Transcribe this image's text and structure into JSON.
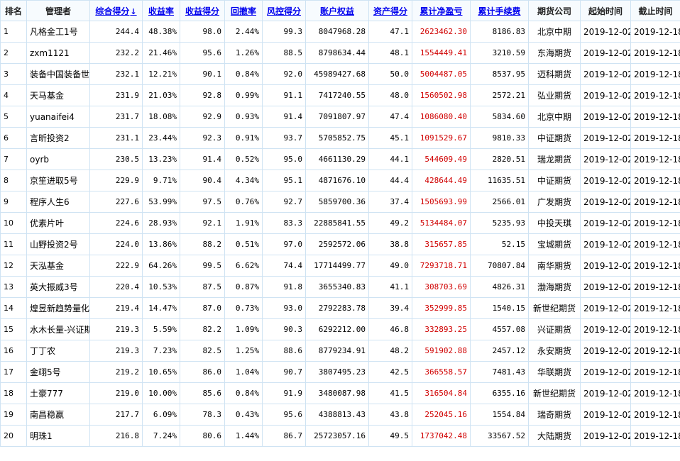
{
  "columns": [
    {
      "key": "rank",
      "label": "排名",
      "sortable": false
    },
    {
      "key": "manager",
      "label": "管理者",
      "sortable": false
    },
    {
      "key": "overall",
      "label": "综合得分",
      "sortable": true,
      "sort_indicator": "↓"
    },
    {
      "key": "return_rate",
      "label": "收益率",
      "sortable": true
    },
    {
      "key": "return_score",
      "label": "收益得分",
      "sortable": true
    },
    {
      "key": "drawdown",
      "label": "回撤率",
      "sortable": true
    },
    {
      "key": "risk_score",
      "label": "风控得分",
      "sortable": true
    },
    {
      "key": "equity",
      "label": "账户权益",
      "sortable": true
    },
    {
      "key": "asset_score",
      "label": "资产得分",
      "sortable": true
    },
    {
      "key": "net_profit",
      "label": "累计净盈亏",
      "sortable": true
    },
    {
      "key": "fees",
      "label": "累计手续费",
      "sortable": true
    },
    {
      "key": "broker",
      "label": "期货公司",
      "sortable": false
    },
    {
      "key": "start",
      "label": "起始时间",
      "sortable": false
    },
    {
      "key": "end",
      "label": "截止时间",
      "sortable": false
    }
  ],
  "colors": {
    "link": "#0000ee",
    "profit": "#d00000",
    "border": "#cfe3f3",
    "sort_arrow": "#e00000"
  },
  "rows": [
    [
      "1",
      "凡格金工1号",
      "244.4",
      "48.38%",
      "98.0",
      "2.44%",
      "99.3",
      "8047968.28",
      "47.1",
      "2623462.30",
      "8186.83",
      "北京中期",
      "2019-12-02",
      "2019-12-18"
    ],
    [
      "2",
      "zxm1121",
      "232.2",
      "21.46%",
      "95.6",
      "1.26%",
      "88.5",
      "8798634.44",
      "48.1",
      "1554449.41",
      "3210.59",
      "东海期货",
      "2019-12-02",
      "2019-12-18"
    ],
    [
      "3",
      "装备中国装备世",
      "232.1",
      "12.21%",
      "90.1",
      "0.84%",
      "92.0",
      "45989427.68",
      "50.0",
      "5004487.05",
      "8537.95",
      "迈科期货",
      "2019-12-02",
      "2019-12-18"
    ],
    [
      "4",
      "天马基金",
      "231.9",
      "21.03%",
      "92.8",
      "0.99%",
      "91.1",
      "7417240.55",
      "48.0",
      "1560502.98",
      "2572.21",
      "弘业期货",
      "2019-12-02",
      "2019-12-18"
    ],
    [
      "5",
      "yuanaifei4",
      "231.7",
      "18.08%",
      "92.9",
      "0.93%",
      "91.4",
      "7091807.97",
      "47.4",
      "1086080.40",
      "5834.60",
      "北京中期",
      "2019-12-02",
      "2019-12-18"
    ],
    [
      "6",
      "言昕投资2",
      "231.1",
      "23.44%",
      "92.3",
      "0.91%",
      "93.7",
      "5705852.75",
      "45.1",
      "1091529.67",
      "9810.33",
      "中证期货",
      "2019-12-02",
      "2019-12-18"
    ],
    [
      "7",
      "oyrb",
      "230.5",
      "13.23%",
      "91.4",
      "0.52%",
      "95.0",
      "4661130.29",
      "44.1",
      "544609.49",
      "2820.51",
      "瑞龙期货",
      "2019-12-02",
      "2019-12-18"
    ],
    [
      "8",
      "京笙进取5号",
      "229.9",
      "9.71%",
      "90.4",
      "4.34%",
      "95.1",
      "4871676.10",
      "44.4",
      "428644.49",
      "11635.51",
      "中证期货",
      "2019-12-02",
      "2019-12-18"
    ],
    [
      "9",
      "程序人生6",
      "227.6",
      "53.99%",
      "97.5",
      "0.76%",
      "92.7",
      "5859700.36",
      "37.4",
      "1505693.99",
      "2566.01",
      "广发期货",
      "2019-12-02",
      "2019-12-18"
    ],
    [
      "10",
      "优素片叶",
      "224.6",
      "28.93%",
      "92.1",
      "1.91%",
      "83.3",
      "22885841.55",
      "49.2",
      "5134484.07",
      "5235.93",
      "中投天琪",
      "2019-12-02",
      "2019-12-18"
    ],
    [
      "11",
      "山野投资2号",
      "224.0",
      "13.86%",
      "88.2",
      "0.51%",
      "97.0",
      "2592572.06",
      "38.8",
      "315657.85",
      "52.15",
      "宝城期货",
      "2019-12-02",
      "2019-12-18"
    ],
    [
      "12",
      "天泓基金",
      "222.9",
      "64.26%",
      "99.5",
      "6.62%",
      "74.4",
      "17714499.77",
      "49.0",
      "7293718.71",
      "70807.84",
      "南华期货",
      "2019-12-02",
      "2019-12-18"
    ],
    [
      "13",
      "英大振威3号",
      "220.4",
      "10.53%",
      "87.5",
      "0.87%",
      "91.8",
      "3655340.83",
      "41.1",
      "308703.69",
      "4826.31",
      "渤海期货",
      "2019-12-02",
      "2019-12-18"
    ],
    [
      "14",
      "煌昱新趋势量化",
      "219.4",
      "14.47%",
      "87.0",
      "0.73%",
      "93.0",
      "2792283.78",
      "39.4",
      "352999.85",
      "1540.15",
      "新世纪期货",
      "2019-12-02",
      "2019-12-18"
    ],
    [
      "15",
      "水木长量-兴证期",
      "219.3",
      "5.59%",
      "82.2",
      "1.09%",
      "90.3",
      "6292212.00",
      "46.8",
      "332893.25",
      "4557.08",
      "兴证期货",
      "2019-12-02",
      "2019-12-18"
    ],
    [
      "16",
      "丁丁农",
      "219.3",
      "7.23%",
      "82.5",
      "1.25%",
      "88.6",
      "8779234.91",
      "48.2",
      "591902.88",
      "2457.12",
      "永安期货",
      "2019-12-02",
      "2019-12-18"
    ],
    [
      "17",
      "金翊5号",
      "219.2",
      "10.65%",
      "86.0",
      "1.04%",
      "90.7",
      "3807495.23",
      "42.5",
      "366558.57",
      "7481.43",
      "华联期货",
      "2019-12-02",
      "2019-12-18"
    ],
    [
      "18",
      "土豪777",
      "219.0",
      "10.00%",
      "85.6",
      "0.84%",
      "91.9",
      "3480087.98",
      "41.5",
      "316504.84",
      "6355.16",
      "新世纪期货",
      "2019-12-02",
      "2019-12-18"
    ],
    [
      "19",
      "南昌稳赢",
      "217.7",
      "6.09%",
      "78.3",
      "0.43%",
      "95.6",
      "4388813.43",
      "43.8",
      "252045.16",
      "1554.84",
      "瑞奇期货",
      "2019-12-02",
      "2019-12-18"
    ],
    [
      "20",
      "明珠1",
      "216.8",
      "7.24%",
      "80.6",
      "1.44%",
      "86.7",
      "25723057.16",
      "49.5",
      "1737042.48",
      "33567.52",
      "大陆期货",
      "2019-12-02",
      "2019-12-18"
    ]
  ]
}
